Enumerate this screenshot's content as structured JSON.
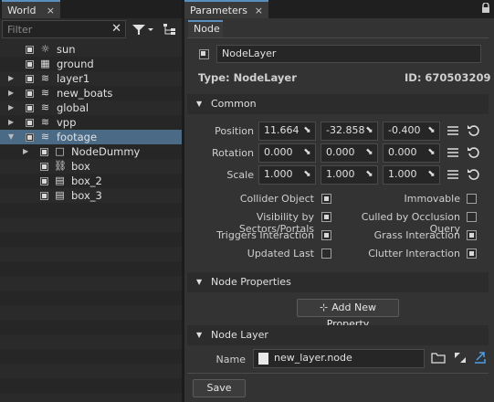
{
  "world_panel": {
    "tab_label": "World",
    "close_glyph": "×",
    "filter_placeholder": "Filter",
    "clear_glyph": "✕",
    "tree": [
      {
        "label": "sun",
        "icon": "sun-icon",
        "glyph": "☼",
        "expandable": false,
        "selected": false,
        "depth": 0
      },
      {
        "label": "ground",
        "icon": "object-icon",
        "glyph": "▦",
        "expandable": false,
        "selected": false,
        "depth": 0
      },
      {
        "label": "layer1",
        "icon": "layer-icon",
        "glyph": "≋",
        "expandable": true,
        "selected": false,
        "depth": 0
      },
      {
        "label": "new_boats",
        "icon": "layer-icon",
        "glyph": "≋",
        "expandable": true,
        "selected": false,
        "depth": 0
      },
      {
        "label": "global",
        "icon": "layer-icon",
        "glyph": "≋",
        "expandable": true,
        "selected": false,
        "depth": 0
      },
      {
        "label": "vpp",
        "icon": "layer-icon",
        "glyph": "≋",
        "expandable": true,
        "selected": false,
        "depth": 0
      },
      {
        "label": "footage",
        "icon": "layer-icon",
        "glyph": "≋",
        "expandable": true,
        "expanded": true,
        "selected": true,
        "depth": 0
      },
      {
        "label": "NodeDummy",
        "icon": "dummy-icon",
        "glyph": "□",
        "expandable": true,
        "selected": false,
        "depth": 1
      },
      {
        "label": "box",
        "icon": "reference-icon",
        "glyph": "⛓",
        "expandable": false,
        "selected": false,
        "depth": 1
      },
      {
        "label": "box_2",
        "icon": "file-icon",
        "glyph": "▤",
        "expandable": false,
        "selected": false,
        "depth": 1
      },
      {
        "label": "box_3",
        "icon": "file-icon",
        "glyph": "▤",
        "expandable": false,
        "selected": false,
        "depth": 1
      }
    ]
  },
  "params_panel": {
    "tab_label": "Parameters",
    "close_glyph": "×",
    "lock_glyph": "🔒",
    "subtab_label": "Node",
    "node_name": "NodeLayer",
    "type_text": "Type: NodeLayer",
    "id_text": "ID: 670503209",
    "common": {
      "title": "Common",
      "rows": [
        {
          "label": "Position",
          "values": [
            "11.664",
            "-32.858",
            "-0.400"
          ]
        },
        {
          "label": "Rotation",
          "values": [
            "0.000",
            "0.000",
            "0.000"
          ]
        },
        {
          "label": "Scale",
          "values": [
            "1.000",
            "1.000",
            "1.000"
          ]
        }
      ],
      "flags_left": [
        {
          "label": "Collider Object",
          "checked": true
        },
        {
          "label": "Visibility by Sectors/Portals",
          "checked": true
        },
        {
          "label": "Triggers Interaction",
          "checked": true
        },
        {
          "label": "Updated Last",
          "checked": false
        }
      ],
      "flags_right": [
        {
          "label": "Immovable",
          "checked": false
        },
        {
          "label": "Culled by Occlusion Query",
          "checked": false
        },
        {
          "label": "Grass Interaction",
          "checked": true
        },
        {
          "label": "Clutter Interaction",
          "checked": true
        }
      ]
    },
    "node_properties": {
      "title": "Node Properties",
      "add_button": "Add New Property",
      "add_glyph": "⊹"
    },
    "node_layer": {
      "title": "Node Layer",
      "name_label": "Name",
      "name_value": "new_layer.node"
    },
    "save_button": "Save"
  }
}
